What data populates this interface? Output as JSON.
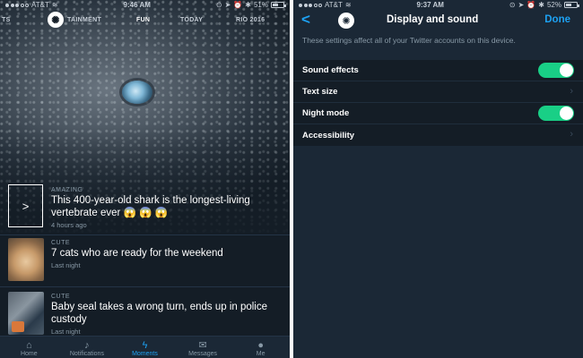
{
  "left": {
    "status": {
      "carrier": "AT&T",
      "time": "9:46 AM",
      "battery_text": "51%",
      "battery_level": 0.51
    },
    "top_tabs": [
      "TS",
      "TAINMENT",
      "FUN",
      "TODAY",
      "RIO 2016"
    ],
    "featured": {
      "category": "AMAZING",
      "headline": "This 400-year-old shark is the longest-living vertebrate ever 😱 😱 😱",
      "meta": "4 hours ago",
      "play_icon": ">"
    },
    "stories": [
      {
        "category": "CUTE",
        "headline": "7 cats who are ready for the weekend",
        "meta": "Last night"
      },
      {
        "category": "CUTE",
        "headline": "Baby seal takes a wrong turn, ends up in police custody",
        "meta": "Last night"
      }
    ],
    "tab_bar": [
      {
        "label": "Home",
        "icon": "home-icon"
      },
      {
        "label": "Notifications",
        "icon": "bell-icon"
      },
      {
        "label": "Moments",
        "icon": "lightning-icon"
      },
      {
        "label": "Messages",
        "icon": "envelope-icon"
      },
      {
        "label": "Me",
        "icon": "person-icon"
      }
    ],
    "active_tab_color": "#1da1f2"
  },
  "right": {
    "status": {
      "carrier": "AT&T",
      "time": "9:37 AM",
      "battery_text": "52%",
      "battery_level": 0.52
    },
    "nav": {
      "back": "<",
      "title": "Display and sound",
      "done": "Done"
    },
    "description": "These settings affect all of your Twitter accounts on this device.",
    "settings": [
      {
        "label": "Sound effects",
        "control": "toggle",
        "on": true
      },
      {
        "label": "Text size",
        "control": "chevron"
      },
      {
        "label": "Night mode",
        "control": "toggle",
        "on": true
      },
      {
        "label": "Accessibility",
        "control": "chevron"
      }
    ],
    "toggle_color": "#19cf86"
  }
}
